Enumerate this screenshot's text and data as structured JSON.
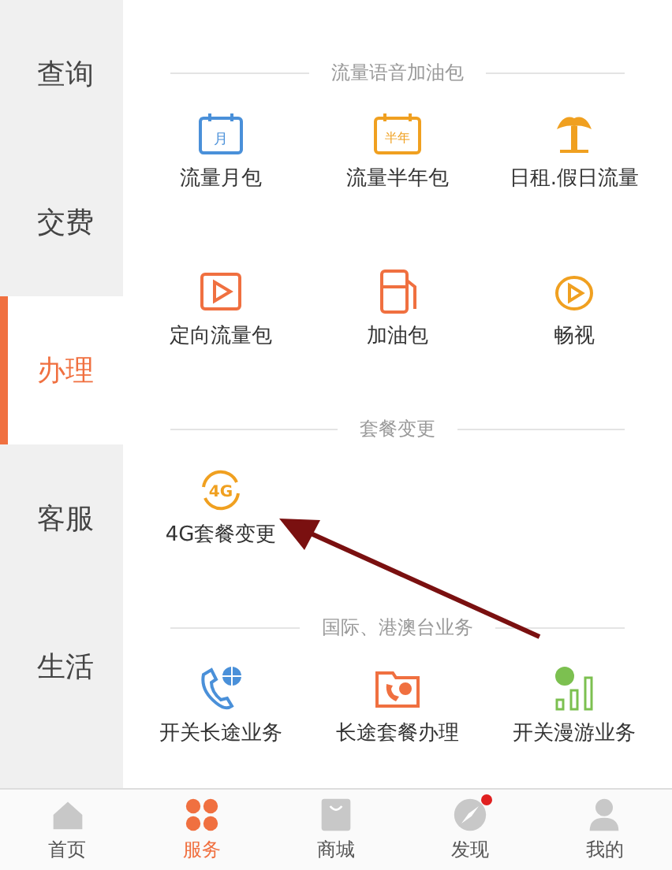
{
  "sidebar": {
    "items": [
      {
        "label": "查询",
        "selected": false
      },
      {
        "label": "交费",
        "selected": false
      },
      {
        "label": "办理",
        "selected": true
      },
      {
        "label": "客服",
        "selected": false
      },
      {
        "label": "生活",
        "selected": false
      }
    ]
  },
  "sections": [
    {
      "title": "流量语音加油包",
      "items": [
        {
          "label": "流量月包",
          "icon_text": "月"
        },
        {
          "label": "流量半年包",
          "icon_text": "半年"
        },
        {
          "label": "日租.假日流量"
        },
        {
          "label": "定向流量包"
        },
        {
          "label": "加油包"
        },
        {
          "label": "畅视"
        }
      ]
    },
    {
      "title": "套餐变更",
      "items": [
        {
          "label": "4G套餐变更",
          "icon_text": "4G"
        }
      ]
    },
    {
      "title": "国际、港澳台业务",
      "items": [
        {
          "label": "开关长途业务"
        },
        {
          "label": "长途套餐办理"
        },
        {
          "label": "开关漫游业务"
        }
      ]
    }
  ],
  "tab_bar": {
    "items": [
      {
        "label": "首页",
        "selected": false
      },
      {
        "label": "服务",
        "selected": true
      },
      {
        "label": "商城",
        "selected": false
      },
      {
        "label": "发现",
        "selected": false,
        "notification": true
      },
      {
        "label": "我的",
        "selected": false
      }
    ]
  }
}
